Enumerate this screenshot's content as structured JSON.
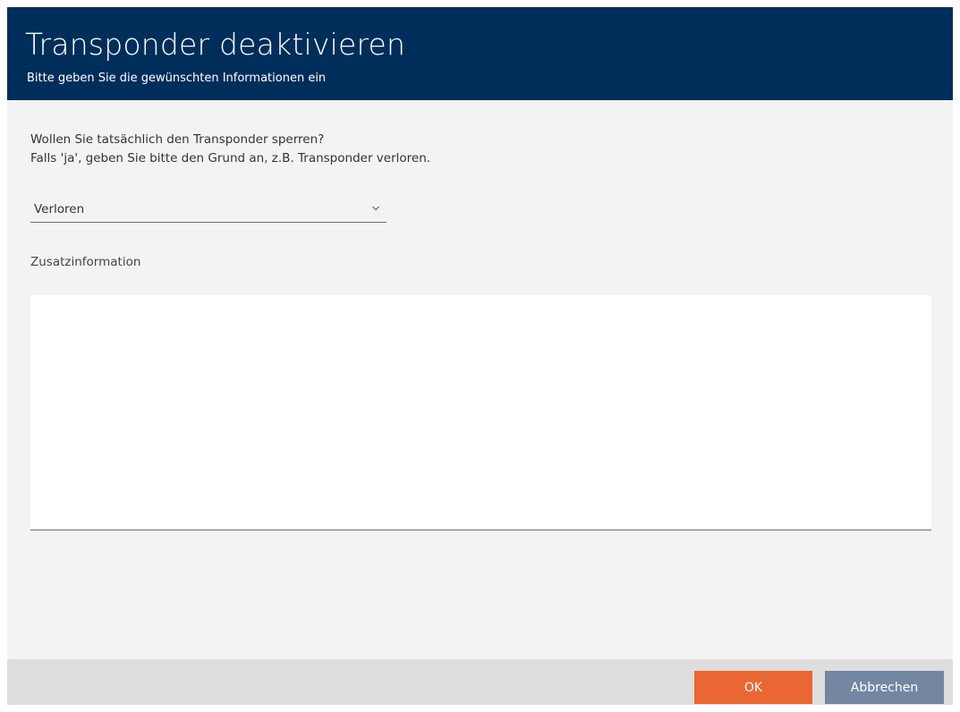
{
  "dialog": {
    "title": "Transponder deaktivieren",
    "subtitle": "Bitte geben Sie die gewünschten Informationen ein"
  },
  "question": {
    "line1": "Wollen Sie tatsächlich den Transponder sperren?",
    "line2": "Falls 'ja', geben Sie bitte den Grund an, z.B. Transponder verloren."
  },
  "reason_select": {
    "value": "Verloren",
    "icon": "chevron-down-icon"
  },
  "additional_info": {
    "label": "Zusatzinformation",
    "value": ""
  },
  "buttons": {
    "ok_label": "OK",
    "cancel_label": "Abbrechen"
  },
  "colors": {
    "header_bg": "#002e5b",
    "body_bg": "#f3f3f3",
    "footer_bg": "#dedede",
    "ok_button": "#ea6633",
    "cancel_button": "#7387a3"
  }
}
